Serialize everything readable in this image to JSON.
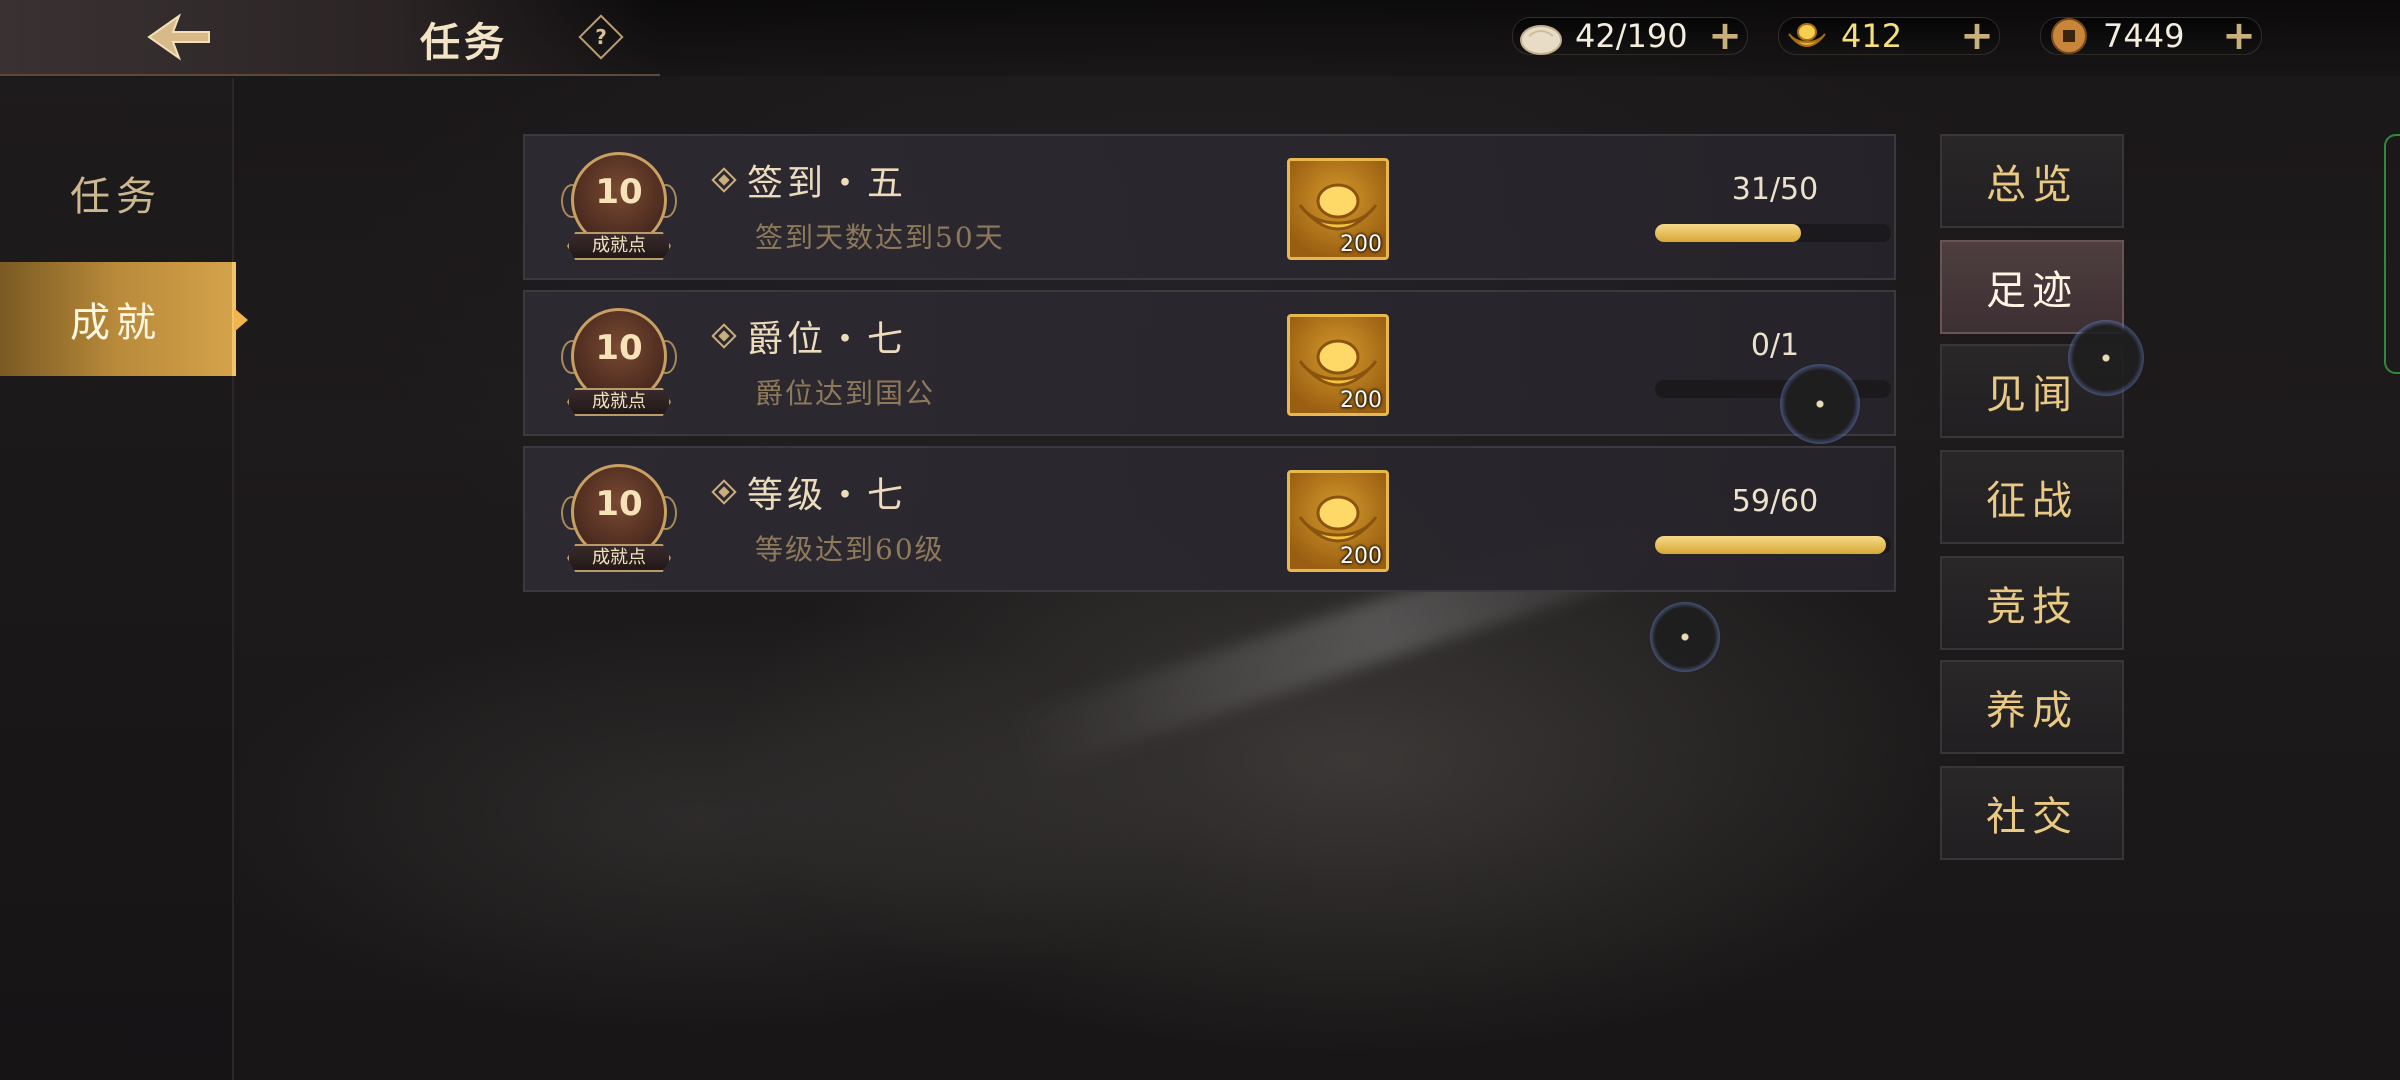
{
  "header": {
    "title": "任务",
    "help_label": "?"
  },
  "resources": [
    {
      "name": "stamina",
      "icon": "bun-icon",
      "value": "42/190"
    },
    {
      "name": "ingot",
      "icon": "gold-ingot-icon",
      "value": "412"
    },
    {
      "name": "coin",
      "icon": "copper-coin-icon",
      "value": "7449"
    }
  ],
  "leftnav": {
    "items": [
      {
        "label": "任务",
        "active": false
      },
      {
        "label": "成就",
        "active": true
      }
    ]
  },
  "achievements": [
    {
      "points": "10",
      "points_label": "成就点",
      "title": "签到・五",
      "desc": "签到天数达到50天",
      "reward_count": "200",
      "progress_text": "31/50",
      "progress": 0.62
    },
    {
      "points": "10",
      "points_label": "成就点",
      "title": "爵位・七",
      "desc": "爵位达到国公",
      "reward_count": "200",
      "progress_text": "0/1",
      "progress": 0.0
    },
    {
      "points": "10",
      "points_label": "成就点",
      "title": "等级・七",
      "desc": "等级达到60级",
      "reward_count": "200",
      "progress_text": "59/60",
      "progress": 0.98
    }
  ],
  "categories": [
    {
      "label": "总览",
      "active": false
    },
    {
      "label": "足迹",
      "active": true
    },
    {
      "label": "见闻",
      "active": false
    },
    {
      "label": "征战",
      "active": false
    },
    {
      "label": "竞技",
      "active": false
    },
    {
      "label": "养成",
      "active": false
    },
    {
      "label": "社交",
      "active": false
    }
  ],
  "colors": {
    "accent_gold": "#d4a24a",
    "progress_fill": "#d6a834"
  }
}
